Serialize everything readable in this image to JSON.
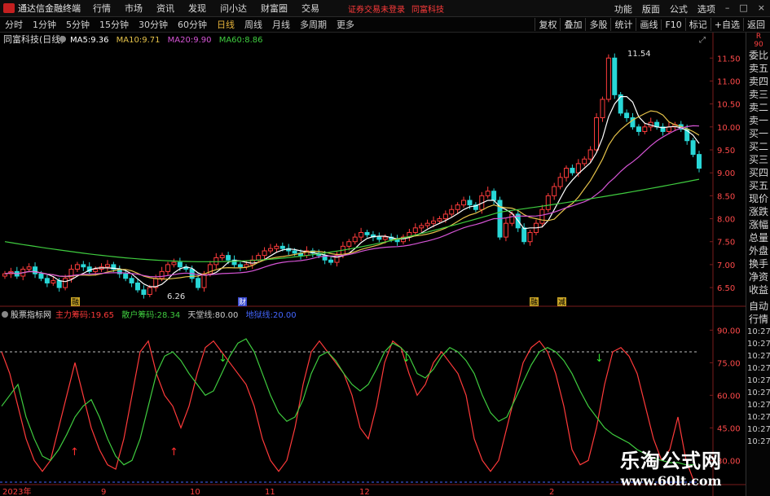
{
  "app": {
    "name": "通达信金融终端",
    "menu": [
      "行情",
      "市场",
      "资讯",
      "发现",
      "问小达",
      "财富圈",
      "交易"
    ],
    "broker_notice": "证券交易未登录",
    "broker_name": "同富科技",
    "right_menu": [
      "功能",
      "版面",
      "公式",
      "选项"
    ]
  },
  "periods": [
    "分时",
    "1分钟",
    "5分钟",
    "15分钟",
    "30分钟",
    "60分钟",
    "日线",
    "周线",
    "月线",
    "多周期",
    "更多"
  ],
  "active_period": "日线",
  "toolbar": [
    "复权",
    "叠加",
    "多股",
    "统计",
    "画线",
    "F10",
    "标记",
    "+自选",
    "返回"
  ],
  "main_chart": {
    "stock": "同富科技(日线)",
    "ma": [
      {
        "label": "MA5:",
        "value": "9.36",
        "color": "#ffffff"
      },
      {
        "label": "MA10:",
        "value": "9.71",
        "color": "#e5c24a"
      },
      {
        "label": "MA20:",
        "value": "9.90",
        "color": "#d655d6"
      },
      {
        "label": "MA60:",
        "value": "8.86",
        "color": "#3fcc3f"
      }
    ],
    "y_ticks": [
      "11.50",
      "11.00",
      "10.50",
      "10.00",
      "9.50",
      "9.00",
      "8.50",
      "8.00",
      "7.50",
      "7.00",
      "6.50"
    ],
    "high_label": "11.54",
    "low_label": "6.26",
    "markers": [
      "融",
      "财",
      "融",
      "减"
    ]
  },
  "indicator": {
    "name": "股票指标网",
    "items": [
      {
        "label": "主力筹码:",
        "value": "19.65",
        "color": "#ff3a3a"
      },
      {
        "label": "散户筹码:",
        "value": "28.34",
        "color": "#3fcc3f"
      },
      {
        "label": "天堂线:",
        "value": "80.00",
        "color": "#cccccc"
      },
      {
        "label": "地狱线:",
        "value": "20.00",
        "color": "#4466ff"
      }
    ],
    "y_ticks": [
      "90.00",
      "75.00",
      "60.00",
      "45.00",
      "30.00"
    ]
  },
  "x_axis": [
    "2023年",
    "9",
    "10",
    "11",
    "12",
    "2"
  ],
  "right_panel": {
    "top_labels": [
      "R",
      "90"
    ],
    "items": [
      "委比",
      "卖五",
      "卖四",
      "卖三",
      "卖二",
      "卖一",
      "买一",
      "买二",
      "买三",
      "买四",
      "买五",
      "现价",
      "涨跌",
      "涨幅",
      "总量",
      "外盘",
      "换手",
      "净资",
      "收益"
    ],
    "lower_items": [
      "自动",
      "行情"
    ],
    "times": [
      "10:27",
      "10:27",
      "10:27",
      "10:27",
      "10:27",
      "10:27",
      "10:27",
      "10:27",
      "10:27",
      "10:27"
    ]
  },
  "watermark": {
    "title": "乐淘公式网",
    "url": "www.60lt.com"
  },
  "chart_data": {
    "type": "line",
    "price_series": {
      "close": [
        6.8,
        6.85,
        6.75,
        6.9,
        6.95,
        6.8,
        6.7,
        6.6,
        6.65,
        6.5,
        6.7,
        6.9,
        7.0,
        6.95,
        6.85,
        6.9,
        6.95,
        7.0,
        6.9,
        6.8,
        6.7,
        6.6,
        6.45,
        6.35,
        6.5,
        6.7,
        6.85,
        7.0,
        7.05,
        6.95,
        6.9,
        6.7,
        6.5,
        6.8,
        7.0,
        7.15,
        7.2,
        7.1,
        7.0,
        6.95,
        7.0,
        7.1,
        7.2,
        7.3,
        7.35,
        7.4,
        7.35,
        7.3,
        7.25,
        7.2,
        7.3,
        7.25,
        7.2,
        7.1,
        7.05,
        7.2,
        7.4,
        7.5,
        7.6,
        7.7,
        7.65,
        7.6,
        7.55,
        7.6,
        7.55,
        7.5,
        7.6,
        7.7,
        7.8,
        7.85,
        7.9,
        7.95,
        8.0,
        8.1,
        8.2,
        8.3,
        8.4,
        8.3,
        8.2,
        8.5,
        8.6,
        8.4,
        7.6,
        7.9,
        8.1,
        7.8,
        7.5,
        7.7,
        7.9,
        8.2,
        8.5,
        8.7,
        8.9,
        9.1,
        9.0,
        9.2,
        9.3,
        9.5,
        10.2,
        10.6,
        11.5,
        10.7,
        10.3,
        10.2,
        10.0,
        9.9,
        10.0,
        10.1,
        10.0,
        9.9,
        10.0,
        10.05,
        9.95,
        9.7,
        9.4,
        9.1
      ],
      "ma60_start": 7.5,
      "ma60_end": 8.86
    },
    "indicator_series": [
      {
        "name": "主力筹码",
        "values": [
          80,
          70,
          55,
          40,
          30,
          25,
          30,
          45,
          60,
          75,
          60,
          45,
          35,
          28,
          26,
          40,
          60,
          80,
          85,
          70,
          60,
          55,
          45,
          55,
          70,
          82,
          85,
          80,
          75,
          70,
          65,
          55,
          40,
          30,
          25,
          30,
          45,
          65,
          80,
          85,
          80,
          75,
          70,
          60,
          45,
          40,
          55,
          75,
          85,
          82,
          70,
          60,
          65,
          75,
          80,
          75,
          70,
          60,
          40,
          30,
          25,
          30,
          45,
          60,
          75,
          82,
          85,
          80,
          70,
          55,
          35,
          28,
          30,
          45,
          65,
          80,
          82,
          78,
          70,
          55,
          40,
          30,
          35,
          50,
          30,
          20
        ]
      },
      {
        "name": "散户筹码",
        "values": [
          55,
          60,
          65,
          50,
          40,
          32,
          30,
          35,
          42,
          50,
          55,
          58,
          50,
          40,
          32,
          28,
          30,
          40,
          55,
          70,
          78,
          80,
          76,
          70,
          65,
          60,
          62,
          70,
          78,
          84,
          86,
          80,
          70,
          60,
          52,
          48,
          50,
          58,
          70,
          78,
          80,
          76,
          70,
          65,
          62,
          65,
          72,
          80,
          84,
          82,
          78,
          70,
          68,
          72,
          78,
          82,
          80,
          76,
          70,
          60,
          52,
          48,
          50,
          58,
          66,
          74,
          80,
          82,
          80,
          76,
          70,
          62,
          55,
          50,
          45,
          42,
          40,
          38,
          35,
          33,
          31,
          30,
          29,
          29,
          28,
          28
        ]
      }
    ],
    "ylim": [
      6.2,
      11.7
    ],
    "indicator_ylim": [
      20,
      95
    ]
  }
}
